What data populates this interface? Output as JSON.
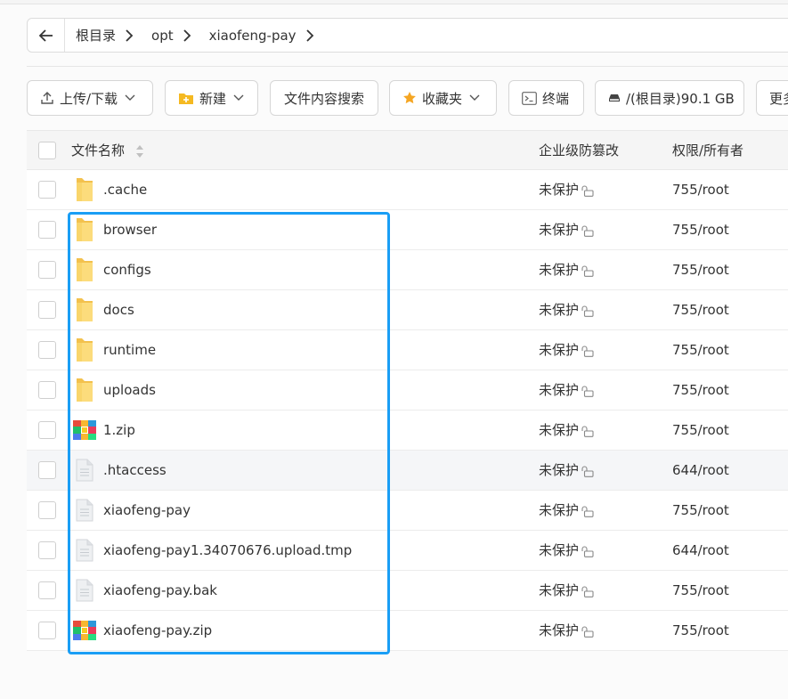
{
  "breadcrumb": {
    "items": [
      "根目录",
      "opt",
      "xiaofeng-pay"
    ]
  },
  "toolbar": {
    "upload_label": "上传/下载",
    "new_label": "新建",
    "search_label": "文件内容搜索",
    "favorites_label": "收藏夹",
    "terminal_label": "终端",
    "disk_label": "/(根目录)90.1 GB",
    "more_label": "更多"
  },
  "table": {
    "headers": {
      "name": "文件名称",
      "protection": "企业级防篡改",
      "permission": "权限/所有者"
    },
    "rows": [
      {
        "name": ".cache",
        "type": "folder",
        "protection": "未保护",
        "permission": "755/root"
      },
      {
        "name": "browser",
        "type": "folder",
        "protection": "未保护",
        "permission": "755/root"
      },
      {
        "name": "configs",
        "type": "folder",
        "protection": "未保护",
        "permission": "755/root"
      },
      {
        "name": "docs",
        "type": "folder",
        "protection": "未保护",
        "permission": "755/root"
      },
      {
        "name": "runtime",
        "type": "folder",
        "protection": "未保护",
        "permission": "755/root"
      },
      {
        "name": "uploads",
        "type": "folder",
        "protection": "未保护",
        "permission": "755/root"
      },
      {
        "name": "1.zip",
        "type": "zip",
        "protection": "未保护",
        "permission": "755/root"
      },
      {
        "name": ".htaccess",
        "type": "file",
        "protection": "未保护",
        "permission": "644/root"
      },
      {
        "name": "xiaofeng-pay",
        "type": "file",
        "protection": "未保护",
        "permission": "755/root"
      },
      {
        "name": "xiaofeng-pay1.34070676.upload.tmp",
        "type": "file",
        "protection": "未保护",
        "permission": "644/root"
      },
      {
        "name": "xiaofeng-pay.bak",
        "type": "file",
        "protection": "未保护",
        "permission": "755/root"
      },
      {
        "name": "xiaofeng-pay.zip",
        "type": "zip",
        "protection": "未保护",
        "permission": "755/root"
      }
    ]
  },
  "colors": {
    "accent": "#1a9ef5",
    "folder": "#f7c948",
    "hover_row": "#f5f6f8"
  }
}
